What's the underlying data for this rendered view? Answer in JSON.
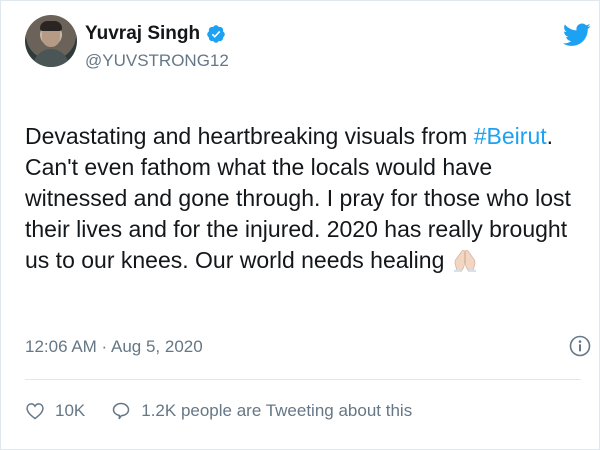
{
  "author": {
    "name": "Yuvraj Singh",
    "handle": "@YUVSTRONG12",
    "verified": true
  },
  "tweet": {
    "text_before": "Devastating and heartbreaking visuals from ",
    "hashtag": "#Beirut",
    "text_after": ". Can't even fathom what the locals would have witnessed and gone through. I pray for those who lost their lives and for the injured. 2020 has really brought us to our knees. Our world needs healing ",
    "emoji": "folded-hands-emoji",
    "timestamp": "12:06 AM · Aug 5, 2020"
  },
  "actions": {
    "likes": "10K",
    "conversation": "1.2K people are Tweeting about this"
  },
  "colors": {
    "brand": "#1da1f2",
    "secondary_text": "#657786",
    "divider": "#e1e8ed"
  },
  "icons": [
    "verified-badge-icon",
    "twitter-bird-icon",
    "info-icon",
    "heart-icon",
    "speech-bubble-icon"
  ]
}
